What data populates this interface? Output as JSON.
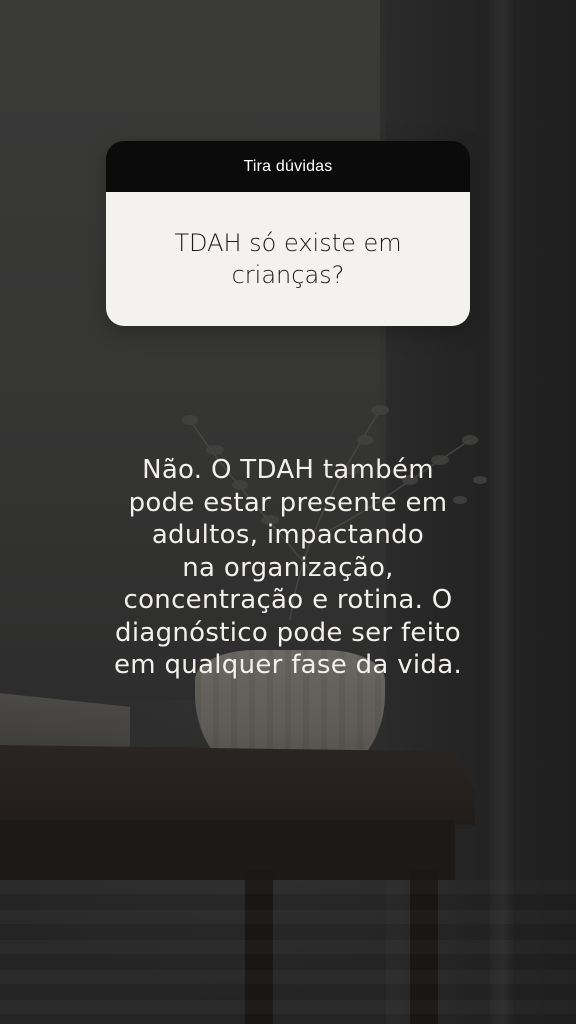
{
  "question_sticker": {
    "header": "Tira dúvidas",
    "question": "TDAH só existe em crianças?"
  },
  "answer": {
    "text": "Não. O TDAH também\npode estar presente em\nadultos, impactando\nna organização,\nconcentração e rotina. O\ndiagnóstico pode ser feito\nem qualquer fase da vida."
  },
  "colors": {
    "sticker_header_bg": "#0b0b0b",
    "sticker_body_bg": "#f4f2ee",
    "answer_text": "#f2f0ec"
  }
}
